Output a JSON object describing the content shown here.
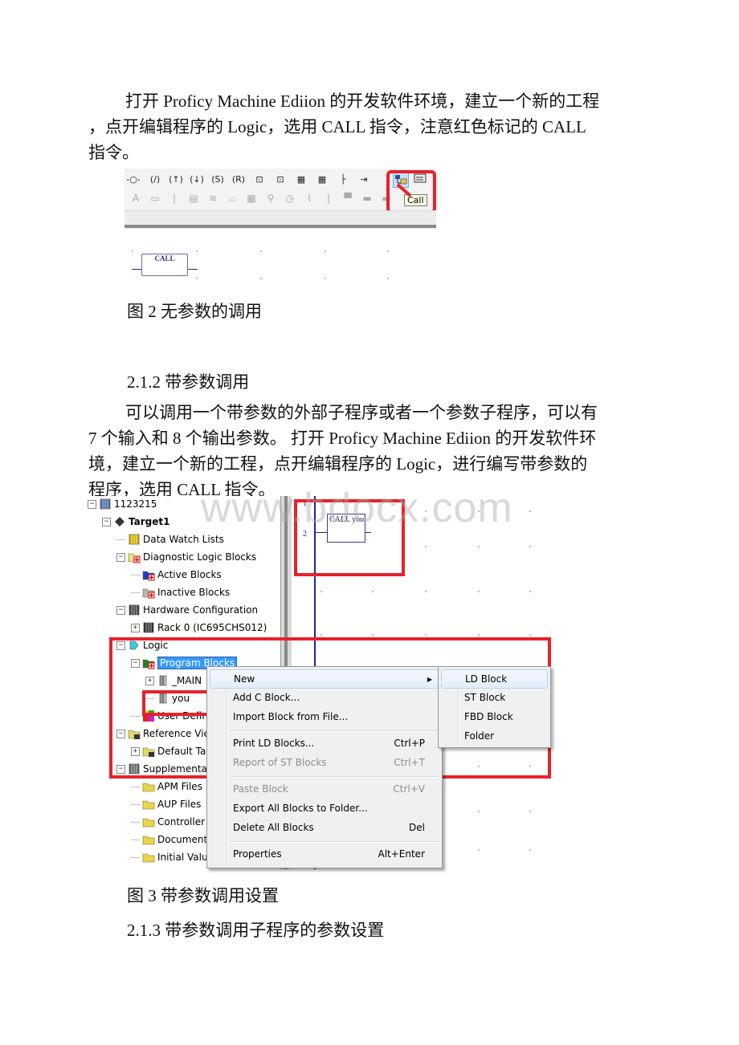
{
  "doc": {
    "para1": "打开 Proficy Machine Ediion 的开发软件环境，建立一个新的工程，点开编辑程序的 Logic，选用 CALL 指令，注意红色标记的 CALL 指令。",
    "para1_lines": [
      "打开 Proficy Machine Ediion 的开发软件环境，建立一个新的工程",
      "，点开编辑程序的 Logic，选用 CALL 指令，注意红色标记的 CALL",
      "指令。"
    ],
    "figure2_caption": "图 2 无参数的调用",
    "heading_212": "2.1.2 带参数调用",
    "para2_lines": [
      "可以调用一个带参数的外部子程序或者一个参数子程序，可以有",
      "7 个输入和 8 个输出参数。 打开 Proficy Machine Ediion 的开发软件环",
      "境，建立一个新的工程，点开编辑程序的 Logic，进行编写带参数的",
      "程序，选用 CALL 指令。"
    ],
    "figure3_caption": "图 3 带参数调用设置",
    "heading_213": "2.1.3 带参数调用子程序的参数设置",
    "watermark": "www.bdocx.com"
  },
  "toolbar": {
    "row1_icons": [
      "contact-icon",
      "coil-icon",
      "negated-coil-icon",
      "positive-transition-coil-icon",
      "negative-transition-coil-icon",
      "set-coil-icon",
      "reset-coil-icon",
      "timer-on-icon",
      "timer-off-icon",
      "counter-up-icon",
      "counter-down-icon",
      "horizontal-wire-icon",
      "jump-icon",
      "call-icon",
      "edit-block-icon"
    ],
    "row1_glyphs": [
      "-○-",
      "(/)",
      "(↑)",
      "(↓)",
      "(S)",
      "(R)",
      "⊡",
      "⊡",
      "▦",
      "▦",
      "├",
      "⇥"
    ],
    "row2_glyphs": [
      "A",
      "▭",
      "|",
      "▤",
      "≋",
      "⌓",
      "▦",
      "⚲",
      "◷",
      "⌇",
      "|",
      "▀",
      "▬",
      "▬"
    ],
    "tooltip": "Call"
  },
  "figure2": {
    "call_block_label": "CALL"
  },
  "tree": {
    "items": [
      {
        "label": "1123215",
        "level": 0,
        "expander": "−",
        "icon": "project-icon",
        "bold": false
      },
      {
        "label": "Target1",
        "level": 1,
        "expander": "−",
        "icon": "target-icon",
        "bold": true
      },
      {
        "label": "Data Watch Lists",
        "level": 2,
        "expander": "",
        "icon": "watch-list-icon",
        "bold": false
      },
      {
        "label": "Diagnostic Logic Blocks",
        "level": 2,
        "expander": "−",
        "icon": "diagnostic-folder-icon",
        "bold": false
      },
      {
        "label": "Active Blocks",
        "level": 3,
        "expander": "",
        "icon": "active-blocks-icon",
        "bold": false
      },
      {
        "label": "Inactive Blocks",
        "level": 3,
        "expander": "",
        "icon": "inactive-blocks-icon",
        "bold": false
      },
      {
        "label": "Hardware Configuration",
        "level": 2,
        "expander": "−",
        "icon": "hardware-icon",
        "bold": false
      },
      {
        "label": "Rack 0 (IC695CHS012)",
        "level": 3,
        "expander": "+",
        "icon": "rack-icon",
        "bold": false
      },
      {
        "label": "Logic",
        "level": 2,
        "expander": "−",
        "icon": "logic-icon",
        "bold": false
      },
      {
        "label": "Program Blocks",
        "level": 3,
        "expander": "−",
        "icon": "program-blocks-icon",
        "bold": false,
        "selected": true
      },
      {
        "label": "_MAIN",
        "level": 4,
        "expander": "+",
        "icon": "block-icon",
        "bold": false
      },
      {
        "label": "you",
        "level": 4,
        "expander": "",
        "icon": "block-icon",
        "bold": false
      },
      {
        "label": "User Define",
        "level": 3,
        "expander": "",
        "icon": "user-defined-icon",
        "bold": false
      },
      {
        "label": "Reference View",
        "level": 2,
        "expander": "−",
        "icon": "reference-folder-icon",
        "bold": false
      },
      {
        "label": "Default Tab",
        "level": 3,
        "expander": "+",
        "icon": "reference-folder-icon",
        "bold": false
      },
      {
        "label": "Supplemental",
        "level": 2,
        "expander": "−",
        "icon": "supplemental-icon",
        "bold": false
      },
      {
        "label": "APM Files",
        "level": 3,
        "expander": "",
        "icon": "folder-icon",
        "bold": false
      },
      {
        "label": "AUP Files",
        "level": 3,
        "expander": "",
        "icon": "folder-icon",
        "bold": false
      },
      {
        "label": "Controller",
        "level": 3,
        "expander": "",
        "icon": "folder-icon",
        "bold": false
      },
      {
        "label": "Documenta",
        "level": 3,
        "expander": "",
        "icon": "folder-icon",
        "bold": false
      },
      {
        "label": "Initial Value",
        "level": 3,
        "expander": "",
        "icon": "folder-icon",
        "bold": false
      }
    ]
  },
  "ladder": {
    "rung_numbers": [
      "1",
      "2"
    ],
    "block_label": "CALL you"
  },
  "context_menu": {
    "items": [
      {
        "label": "New",
        "shortcut": "",
        "submenu": true,
        "disabled": false,
        "hot": true
      },
      {
        "label": "Add C Block...",
        "shortcut": "",
        "disabled": false
      },
      {
        "label": "Import Block from File...",
        "shortcut": "",
        "disabled": false
      },
      {
        "separator": true
      },
      {
        "label": "Print LD Blocks...",
        "shortcut": "Ctrl+P",
        "disabled": false
      },
      {
        "label": "Report of ST Blocks",
        "shortcut": "Ctrl+T",
        "disabled": true
      },
      {
        "separator": true
      },
      {
        "label": "Paste Block",
        "shortcut": "Ctrl+V",
        "disabled": true
      },
      {
        "label": "Export All Blocks to Folder...",
        "shortcut": "",
        "disabled": false
      },
      {
        "label": "Delete All Blocks",
        "shortcut": "Del",
        "disabled": false
      },
      {
        "separator": true
      },
      {
        "label": "Properties",
        "shortcut": "Alt+Enter",
        "disabled": false
      }
    ]
  },
  "submenu": {
    "items": [
      {
        "label": "LD Block",
        "hot": true
      },
      {
        "label": "ST Block"
      },
      {
        "label": "FBD Block"
      },
      {
        "label": "Folder"
      }
    ]
  },
  "colors": {
    "highlight_red": "#e8212b",
    "selection_blue": "#3399ff",
    "ladder_blue": "#22229a"
  }
}
